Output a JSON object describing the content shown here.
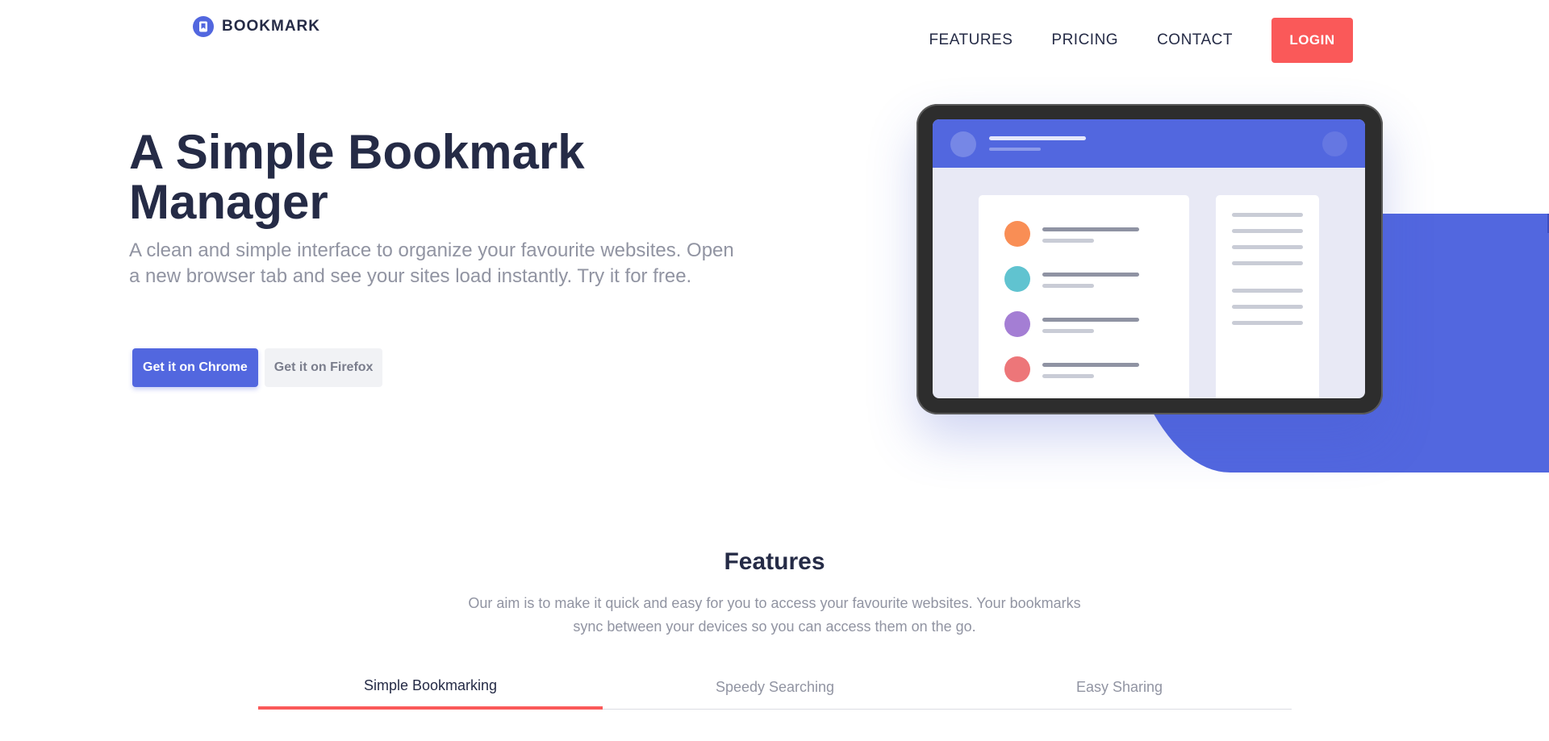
{
  "header": {
    "brand": "BOOKMARK",
    "nav": [
      "FEATURES",
      "PRICING",
      "CONTACT"
    ],
    "login_label": "LOGIN"
  },
  "hero": {
    "title": "A Simple Bookmark Manager",
    "description": "A clean and simple interface to organize your favourite websites. Open a new browser tab and see your sites load instantly. Try it for free.",
    "chrome_button": "Get it on Chrome",
    "firefox_button": "Get it on Firefox"
  },
  "illustration": {
    "row_colors": [
      "#f98e55",
      "#60c3d0",
      "#a47ed4",
      "#ed7679"
    ]
  },
  "features": {
    "title": "Features",
    "description": "Our aim is to make it quick and easy for you to access your favourite websites. Your bookmarks sync between your devices so you can access them on the go.",
    "tabs": [
      "Simple Bookmarking",
      "Speedy Searching",
      "Easy Sharing"
    ],
    "active_tab": "Simple Bookmarking"
  },
  "colors": {
    "primary": "#5267df",
    "accent": "#fa5959",
    "dark": "#252b46",
    "muted": "#9194a2"
  }
}
